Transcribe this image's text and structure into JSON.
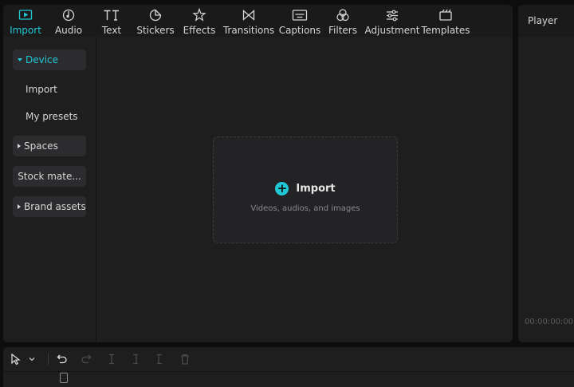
{
  "tabs": [
    {
      "label": "Import",
      "icon": "import-icon",
      "active": true
    },
    {
      "label": "Audio",
      "icon": "audio-icon",
      "active": false
    },
    {
      "label": "Text",
      "icon": "text-icon",
      "active": false
    },
    {
      "label": "Stickers",
      "icon": "stickers-icon",
      "active": false
    },
    {
      "label": "Effects",
      "icon": "effects-icon",
      "active": false
    },
    {
      "label": "Transitions",
      "icon": "transitions-icon",
      "active": false
    },
    {
      "label": "Captions",
      "icon": "captions-icon",
      "active": false
    },
    {
      "label": "Filters",
      "icon": "filters-icon",
      "active": false
    },
    {
      "label": "Adjustment",
      "icon": "adjustment-icon",
      "active": false
    },
    {
      "label": "Templates",
      "icon": "templates-icon",
      "active": false
    }
  ],
  "sidebar": {
    "items": [
      {
        "label": "Device",
        "expanded": true,
        "active": true
      },
      {
        "label": "Import"
      },
      {
        "label": "My presets"
      },
      {
        "label": "Spaces",
        "expanded": false
      },
      {
        "label": "Stock mate..."
      },
      {
        "label": "Brand assets",
        "expanded": false
      }
    ]
  },
  "dropzone": {
    "title": "Import",
    "subtitle": "Videos, audios, and images"
  },
  "player": {
    "title": "Player",
    "timecode": "00:00:00:00"
  },
  "toolbar": {
    "icons": [
      "select-arrow-icon",
      "dropdown-chevron-icon",
      "undo-icon",
      "redo-icon",
      "split-icon",
      "trim-left-icon",
      "trim-right-icon",
      "delete-icon"
    ]
  },
  "colors": {
    "accent": "#22c7d6",
    "panel": "#1e1e1f",
    "background": "#0d0d0e"
  }
}
